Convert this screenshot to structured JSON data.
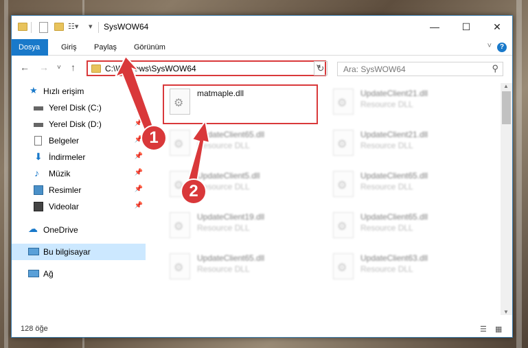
{
  "window": {
    "title": "SysWOW64",
    "minimize_glyph": "—",
    "maximize_glyph": "☐",
    "close_glyph": "✕"
  },
  "ribbon": {
    "tabs": [
      "Dosya",
      "Giriş",
      "Paylaş",
      "Görünüm"
    ],
    "help_glyph": "?"
  },
  "address": {
    "path": "C:\\Windows\\SysWOW64",
    "refresh_glyph": "↻"
  },
  "search": {
    "placeholder": "Ara: SysWOW64"
  },
  "nav": {
    "items": [
      {
        "label": "Hızlı erişim",
        "icon": "star-icon",
        "pinned": false
      },
      {
        "label": "Yerel Disk (C:)",
        "icon": "drive-icon",
        "pinned": true
      },
      {
        "label": "Yerel Disk (D:)",
        "icon": "drive-icon",
        "pinned": true
      },
      {
        "label": "Belgeler",
        "icon": "documents-icon",
        "pinned": true
      },
      {
        "label": "İndirmeler",
        "icon": "download-icon",
        "pinned": true
      },
      {
        "label": "Müzik",
        "icon": "music-icon",
        "pinned": true
      },
      {
        "label": "Resimler",
        "icon": "pictures-icon",
        "pinned": true
      },
      {
        "label": "Videolar",
        "icon": "videos-icon",
        "pinned": true
      },
      {
        "label": "OneDrive",
        "icon": "cloud-icon",
        "pinned": false
      },
      {
        "label": "Bu bilgisayar",
        "icon": "computer-icon",
        "pinned": false
      },
      {
        "label": "Ağ",
        "icon": "network-icon",
        "pinned": false
      }
    ]
  },
  "files": {
    "highlighted": {
      "name": "matmaple.dll"
    },
    "col1": [
      {
        "name": "UpdateClient65.dll",
        "type": "Resource DLL"
      },
      {
        "name": "UpdateClient5.dll",
        "type": "Resource DLL"
      },
      {
        "name": "UpdateClient19.dll",
        "type": "Resource DLL"
      },
      {
        "name": "UpdateClient65.dll",
        "type": "Resource DLL"
      }
    ],
    "col2": [
      {
        "name": "UpdateClient21.dll",
        "type": "Resource DLL"
      },
      {
        "name": "UpdateClient21.dll",
        "type": "Resource DLL"
      },
      {
        "name": "UpdateClient65.dll",
        "type": "Resource DLL"
      },
      {
        "name": "UpdateClient65.dll",
        "type": "Resource DLL"
      },
      {
        "name": "UpdateClient63.dll",
        "type": "Resource DLL"
      }
    ]
  },
  "status": {
    "count": "128 öğe"
  },
  "annotations": {
    "step1": "1",
    "step2": "2"
  },
  "colors": {
    "accent": "#1979ca",
    "highlight": "#d9383a"
  }
}
